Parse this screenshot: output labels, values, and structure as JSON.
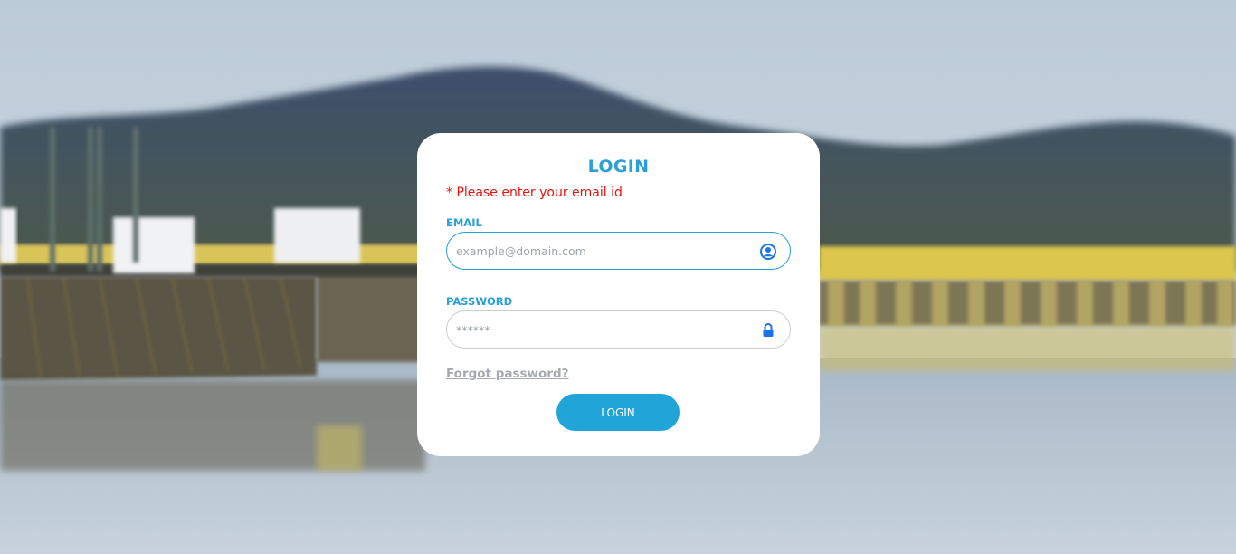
{
  "login_form": {
    "title": "LOGIN",
    "error_message": "* Please enter your email id",
    "email": {
      "label": "EMAIL",
      "placeholder": "example@domain.com",
      "value": "",
      "icon": "user-circle-icon"
    },
    "password": {
      "label": "PASSWORD",
      "placeholder": "******",
      "value": "",
      "icon": "lock-icon"
    },
    "forgot_password_link": "Forgot password?",
    "submit_label": "LOGIN"
  },
  "colors": {
    "accent": "#2aa0d6",
    "button": "#21a5d9",
    "error": "#e8120c",
    "icon_blue": "#1a73e8",
    "muted_link": "#a6aab0"
  }
}
